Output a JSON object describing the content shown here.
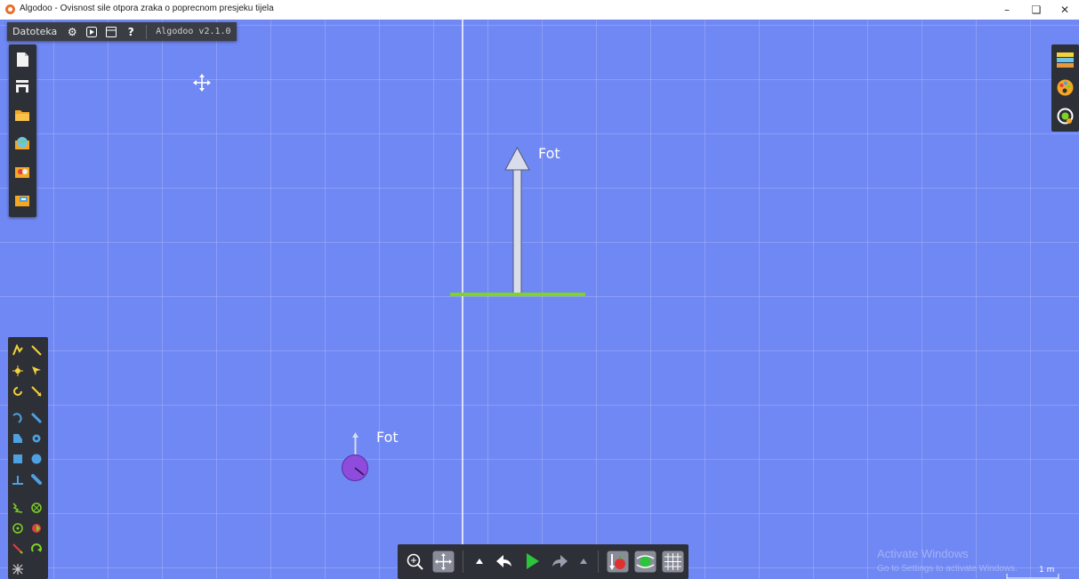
{
  "window": {
    "title": "Algodoo - Ovisnost sile otpora zraka o poprecnom presjeku tijela",
    "controls": {
      "minimize": "–",
      "restore": "❏",
      "close": "✕"
    }
  },
  "menu": {
    "file_label": "Datoteka",
    "settings_icon": "⚙",
    "play_icon": "▶",
    "window_icon": "▤",
    "help_icon": "?",
    "version": "Algodoo v2.1.0"
  },
  "scene": {
    "force_label_large": "Fot",
    "force_label_small": "Fot",
    "colors": {
      "background": "#7088f3",
      "plank": "#7fd321",
      "ball": "#8f4bdc",
      "arrow": "#d9dcea"
    }
  },
  "toolbar": {
    "zoom_icon": "zoom-in-icon",
    "pan_icon": "pan-icon",
    "undo_icon": "undo-icon",
    "play_icon": "play-icon",
    "redo_icon": "redo-icon",
    "gravity_icon": "gravity-icon",
    "air_icon": "air-friction-icon",
    "grid_icon": "grid-icon"
  },
  "watermark": {
    "line1": "Activate Windows",
    "line2": "Go to Settings to activate Windows."
  },
  "scale_label": "1 m"
}
